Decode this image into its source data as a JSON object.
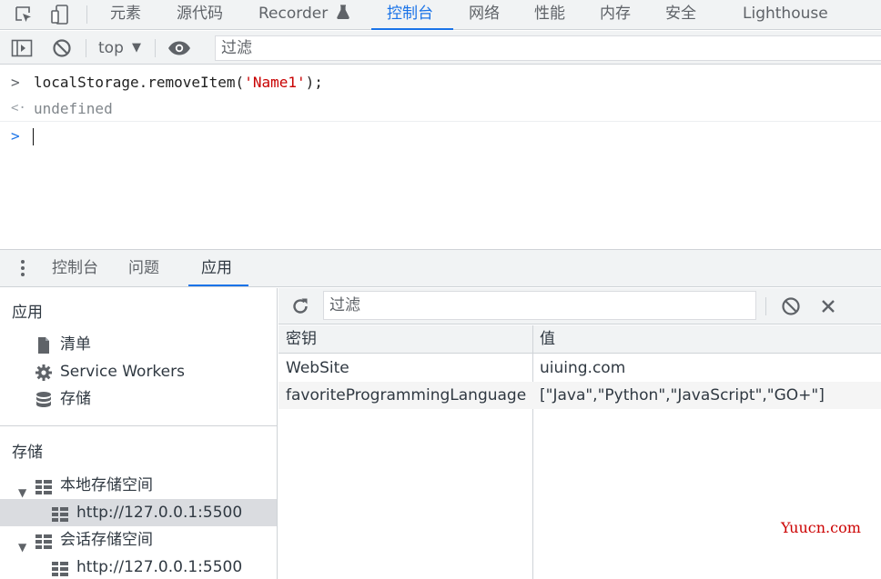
{
  "main_tabs": {
    "elements": "元素",
    "sources": "源代码",
    "recorder": "Recorder",
    "console": "控制台",
    "network": "网络",
    "performance": "性能",
    "memory": "内存",
    "security": "安全",
    "lighthouse": "Lighthouse"
  },
  "console_toolbar": {
    "context": "top",
    "filter_placeholder": "过滤"
  },
  "console_lines": {
    "command_code": "localStorage.removeItem(",
    "command_arg": "'Name1'",
    "command_end": ");",
    "result": "undefined"
  },
  "drawer_tabs": {
    "console": "控制台",
    "issues": "问题",
    "application": "应用"
  },
  "sidebar": {
    "app_title": "应用",
    "manifest": "清单",
    "service_workers": "Service Workers",
    "storage_item": "存储",
    "storage_title": "存储",
    "local_storage": "本地存储空间",
    "local_origin": "http://127.0.0.1:5500",
    "session_storage": "会话存储空间",
    "session_origin": "http://127.0.0.1:5500"
  },
  "storage_pane": {
    "filter_placeholder": "过滤",
    "col_key": "密钥",
    "col_value": "值",
    "rows": [
      {
        "key": "WebSite",
        "value": "uiuing.com"
      },
      {
        "key": "favoriteProgrammingLanguage",
        "value": "[\"Java\",\"Python\",\"JavaScript\",\"GO+\"]"
      }
    ]
  },
  "watermark": "Yuucn.com",
  "colors": {
    "accent": "#1a73e8",
    "string_red": "#c80000",
    "toolbar_bg": "#f1f3f4"
  }
}
